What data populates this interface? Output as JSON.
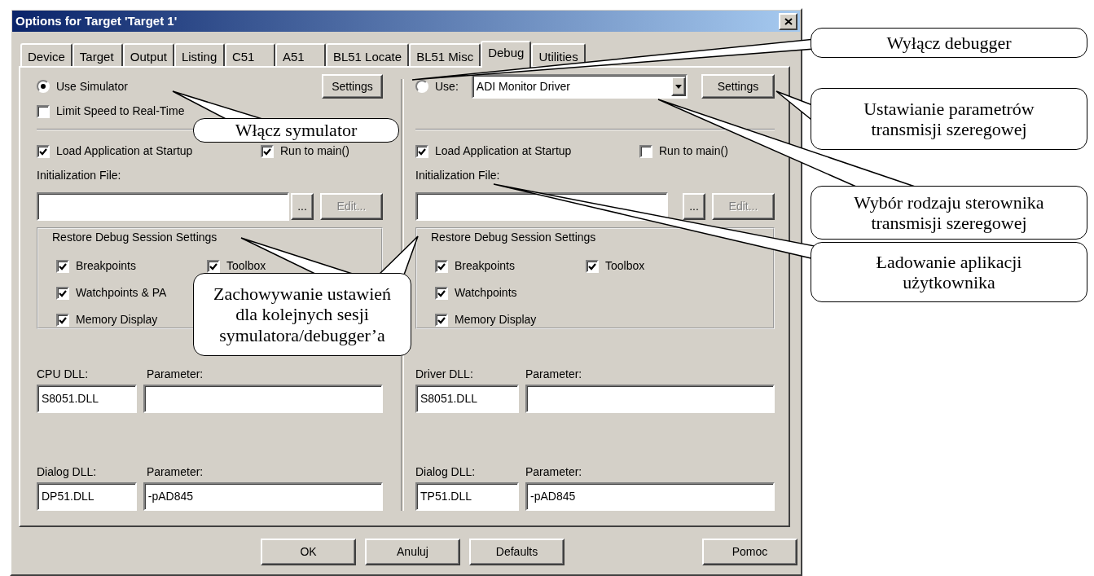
{
  "window": {
    "title": "Options for Target 'Target 1'"
  },
  "tabs": [
    {
      "label": "Device",
      "selected": false
    },
    {
      "label": "Target",
      "selected": false
    },
    {
      "label": "Output",
      "selected": false
    },
    {
      "label": "Listing",
      "selected": false
    },
    {
      "label": "C51",
      "selected": false
    },
    {
      "label": "A51",
      "selected": false
    },
    {
      "label": "BL51 Locate",
      "selected": false
    },
    {
      "label": "BL51 Misc",
      "selected": false
    },
    {
      "label": "Debug",
      "selected": true
    },
    {
      "label": "Utilities",
      "selected": false
    }
  ],
  "panels": [
    {
      "mode": {
        "label": "Use Simulator",
        "selected": true
      },
      "settings_button": "Settings",
      "limit_speed": {
        "label": "Limit Speed to Real-Time",
        "checked": false
      },
      "load_application": {
        "label": "Load Application at Startup",
        "checked": true
      },
      "run_to_main": {
        "label": "Run to main()",
        "checked": true
      },
      "init_file_label": "Initialization File:",
      "browse_button": "...",
      "edit_button": {
        "label": "Edit...",
        "disabled": true
      },
      "restore": {
        "title": "Restore Debug Session Settings",
        "columns": [
          [
            {
              "label": "Breakpoints",
              "checked": true
            },
            {
              "label": "Watchpoints & PA",
              "checked": true
            },
            {
              "label": "Memory Display",
              "checked": true
            }
          ],
          [
            {
              "label": "Toolbox",
              "checked": true
            }
          ]
        ]
      },
      "dlls": [
        {
          "label": "CPU DLL:",
          "value": "S8051.DLL",
          "parameter_label": "Parameter:"
        },
        {
          "label": "Dialog DLL:",
          "value": "DP51.DLL",
          "parameter_label": "Parameter:",
          "parameter_value": "-pAD845"
        }
      ]
    },
    {
      "mode": {
        "label": "Use:",
        "selected": false
      },
      "driver": "ADI Monitor Driver",
      "settings_button": "Settings",
      "load_application": {
        "label": "Load Application at Startup",
        "checked": true
      },
      "run_to_main": {
        "label": "Run to main()",
        "checked": false
      },
      "init_file_label": "Initialization File:",
      "browse_button": "...",
      "edit_button": {
        "label": "Edit...",
        "disabled": true
      },
      "restore": {
        "title": "Restore Debug Session Settings",
        "columns": [
          [
            {
              "label": "Breakpoints",
              "checked": true
            },
            {
              "label": "Watchpoints",
              "checked": true
            },
            {
              "label": "Memory Display",
              "checked": true
            }
          ],
          [
            {
              "label": "Toolbox",
              "checked": true
            }
          ]
        ]
      },
      "dlls": [
        {
          "label": "Driver DLL:",
          "value": "S8051.DLL",
          "parameter_label": "Parameter:"
        },
        {
          "label": "Dialog DLL:",
          "value": "TP51.DLL",
          "parameter_label": "Parameter:",
          "parameter_value": "-pAD845"
        }
      ]
    }
  ],
  "buttons": [
    {
      "label": "OK"
    },
    {
      "label": "Anuluj"
    },
    {
      "label": "Defaults"
    },
    {
      "label": "Pomoc"
    }
  ],
  "callouts": [
    {
      "text": "Włącz symulator"
    },
    {
      "text": "Zachowywanie ustawień\ndla kolejnych sesji\nsymulatora/debugger’a"
    },
    {
      "text": "Wyłącz debugger"
    },
    {
      "text": "Ustawianie parametrów\ntransmisji szeregowej"
    },
    {
      "text": "Wybór rodzaju sterownika\ntransmisji szeregowej"
    },
    {
      "text": "Ładowanie aplikacji\nużytkownika"
    }
  ]
}
